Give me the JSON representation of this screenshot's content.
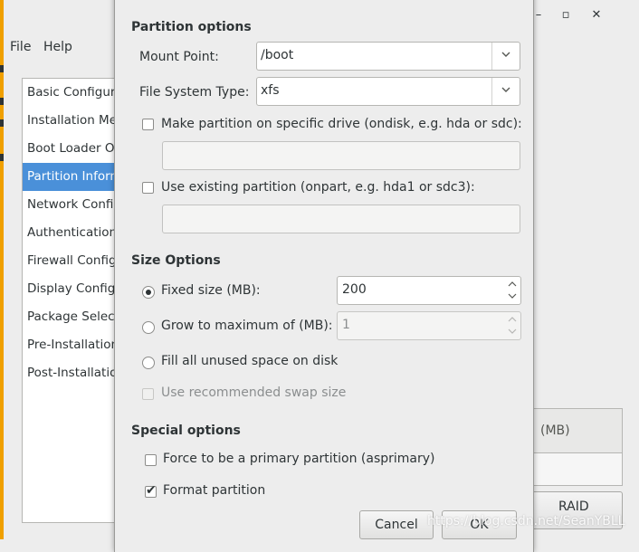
{
  "main_window": {
    "menu": [
      "File",
      "Help"
    ],
    "sidebar_items": [
      {
        "label": "Basic Configuration",
        "selected": false
      },
      {
        "label": "Installation Method",
        "selected": false
      },
      {
        "label": "Boot Loader Options",
        "selected": false
      },
      {
        "label": "Partition Information",
        "selected": true
      },
      {
        "label": "Network Configuration",
        "selected": false
      },
      {
        "label": "Authentication",
        "selected": false
      },
      {
        "label": "Firewall Configuration",
        "selected": false
      },
      {
        "label": "Display Configuration",
        "selected": false
      },
      {
        "label": "Package Selection",
        "selected": false
      },
      {
        "label": "Pre-Installation Script",
        "selected": false
      },
      {
        "label": "Post-Installation Script",
        "selected": false
      }
    ],
    "window_controls": {
      "minimize": "–",
      "maximize": "▫",
      "close": "✕"
    },
    "table_header_fragment": "(MB)",
    "raid_button": "RAID"
  },
  "dialog": {
    "partition_options": {
      "title": "Partition options",
      "mount_point_label": "Mount Point:",
      "mount_point_value": "/boot",
      "fs_type_label": "File System Type:",
      "fs_type_value": "xfs",
      "ondisk_label": "Make partition on specific drive (ondisk, e.g. hda or sdc):",
      "ondisk_checked": false,
      "ondisk_value": "",
      "onpart_label": "Use existing partition (onpart, e.g. hda1 or sdc3):",
      "onpart_checked": false,
      "onpart_value": ""
    },
    "size_options": {
      "title": "Size Options",
      "fixed_label": "Fixed size (MB):",
      "fixed_value": "200",
      "grow_label": "Grow to maximum of (MB):",
      "grow_value": "1",
      "fill_label": "Fill all unused space on disk",
      "swap_label": "Use recommended swap size",
      "selected": "fixed"
    },
    "special_options": {
      "title": "Special options",
      "primary_label": "Force to be a primary partition (asprimary)",
      "primary_checked": false,
      "format_label": "Format partition",
      "format_checked": true
    },
    "buttons": {
      "cancel": "Cancel",
      "ok": "OK"
    }
  },
  "watermark": "https://blog.csdn.net/SeanYBLL",
  "colors": {
    "selection": "#4a90d9",
    "accent_edge": "#f0a000"
  }
}
